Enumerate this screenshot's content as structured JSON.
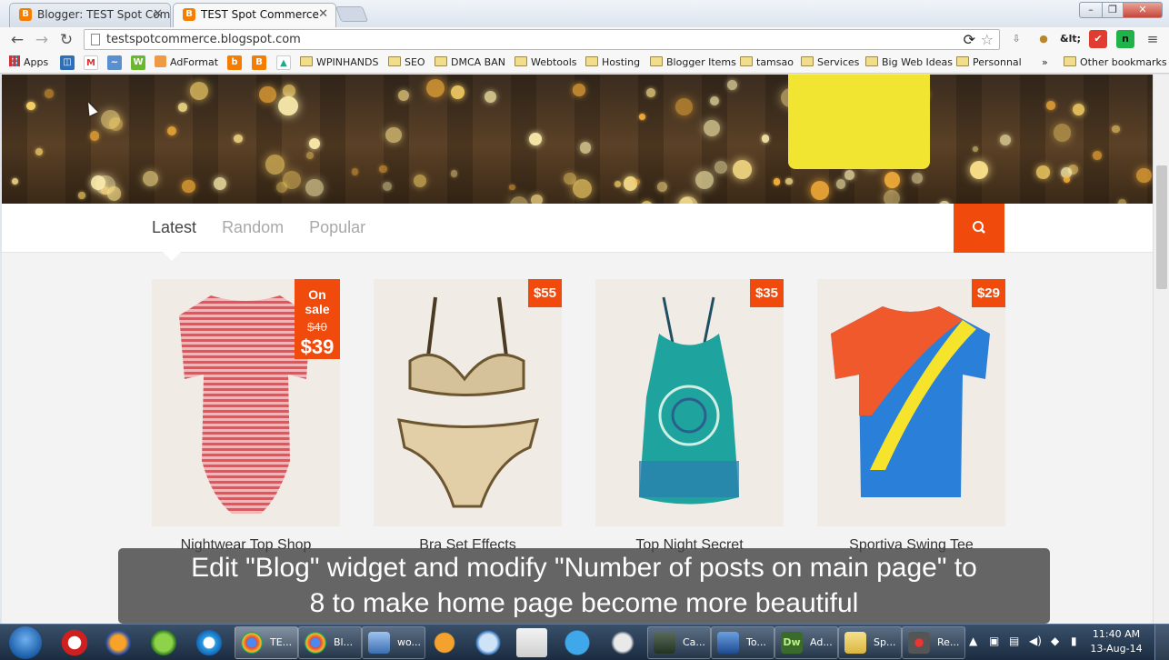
{
  "browser": {
    "tabs": [
      {
        "label": "Blogger: TEST Spot Comm",
        "favicon": "blogger-icon",
        "active": false
      },
      {
        "label": "TEST Spot Commerce",
        "favicon": "blogger-icon",
        "active": true
      }
    ],
    "address": "testspotcommerce.blogspot.com",
    "bookmarks": {
      "apps_label": "Apps",
      "adformat_label": "AdFormat",
      "folders": [
        "WPINHANDS",
        "SEO",
        "DMCA BAN",
        "Webtools",
        "Hosting",
        "Blogger Items",
        "tamsao",
        "Services",
        "Big Web Ideas",
        "Personnal"
      ],
      "overflow": "»",
      "other": "Other bookmarks"
    },
    "extension_text": "&lt;"
  },
  "page": {
    "nav_tabs": [
      "Latest",
      "Random",
      "Popular"
    ],
    "active_tab": "Latest",
    "accent_color": "#f04a0c",
    "products": [
      {
        "title": "Nightwear Top Shop",
        "badge": "On sale",
        "old_price": "$40",
        "price": "$39",
        "image": "striped-red-bodysuit"
      },
      {
        "title": "Bra Set Effects",
        "price": "$55",
        "image": "lace-bra-set"
      },
      {
        "title": "Top Night Secret",
        "price": "$35",
        "image": "teal-tank-top"
      },
      {
        "title": "Sportiva Swing Tee",
        "price": "$29",
        "image": "orange-blue-tshirt"
      }
    ]
  },
  "caption": {
    "line1": "Edit \"Blog\" widget and modify \"Number of posts on main page\" to",
    "line2": "8 to make home page become more beautiful"
  },
  "taskbar": {
    "tasks": [
      {
        "label": "TE...",
        "icon": "chrome-icon",
        "active": true
      },
      {
        "label": "Bl...",
        "icon": "chrome-icon",
        "active": false
      },
      {
        "label": "wo...",
        "icon": "box-icon",
        "active": false
      },
      {
        "label": "Ca...",
        "icon": "camtasia-icon",
        "active": false
      },
      {
        "label": "To...",
        "icon": "floppy-icon",
        "active": false
      },
      {
        "label": "Ad...",
        "icon": "dreamweaver-icon",
        "active": false
      },
      {
        "label": "Sp...",
        "icon": "folder-icon",
        "active": false
      },
      {
        "label": "Re...",
        "icon": "recorder-icon",
        "active": false
      }
    ],
    "time": "11:40 AM",
    "date": "13-Aug-14"
  }
}
